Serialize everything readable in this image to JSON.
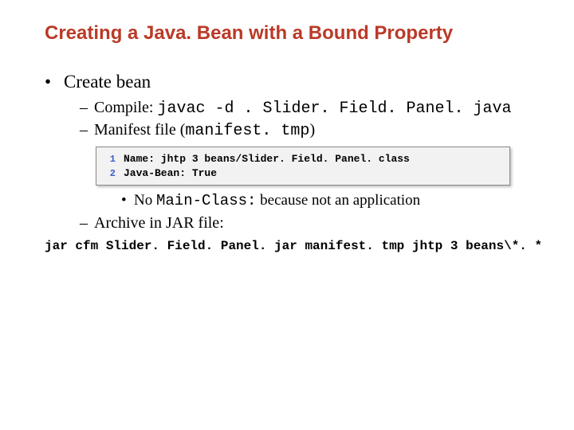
{
  "title": "Creating a Java. Bean with a Bound Property",
  "bullets": {
    "b1": "Create bean",
    "b2a_prefix": "Compile: ",
    "b2a_code": "javac -d . Slider. Field. Panel. java",
    "b2b_prefix": "Manifest file (",
    "b2b_code": "manifest. tmp",
    "b2b_suffix": ")",
    "b3_prefix": "No ",
    "b3_code": "Main-Class:",
    "b3_suffix": " because not an application",
    "b4": "Archive in JAR file:"
  },
  "code": {
    "l1_no": "1",
    "l1": "Name: jhtp 3 beans/Slider. Field. Panel. class",
    "l2_no": "2",
    "l2": "Java-Bean: True"
  },
  "jar_cmd": "jar cfm Slider. Field. Panel. jar manifest. tmp jhtp 3 beans\\*. *"
}
